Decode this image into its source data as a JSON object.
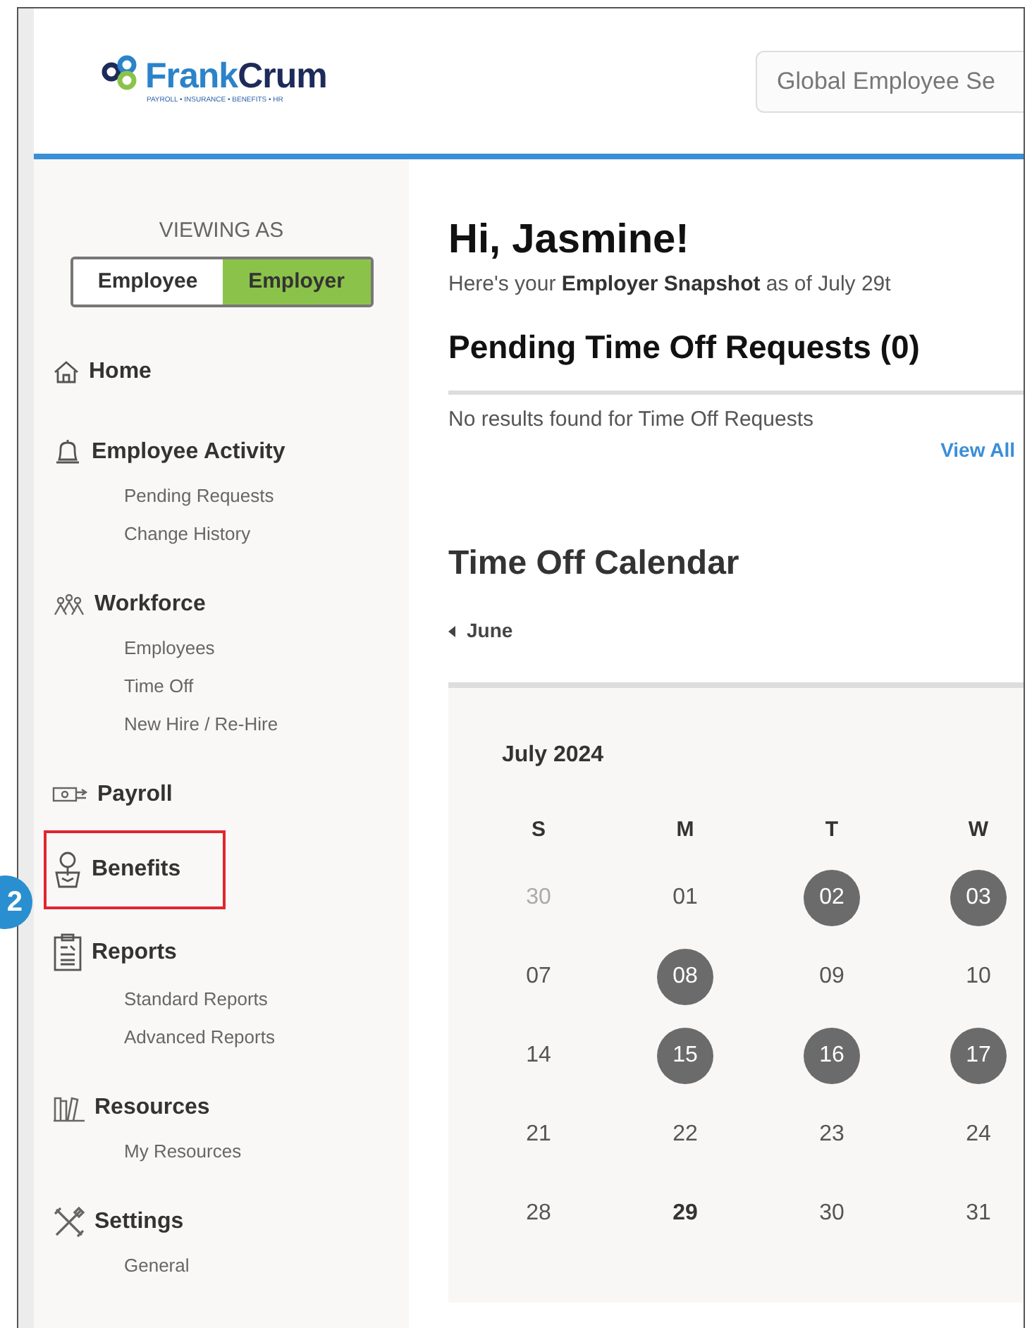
{
  "logo": {
    "name_parts": [
      "Frank",
      "Crum"
    ],
    "tagline": "PAYROLL • INSURANCE • BENEFITS • HR"
  },
  "search": {
    "placeholder": "Global Employee Se"
  },
  "viewing_as": {
    "label": "VIEWING AS",
    "options": [
      {
        "label": "Employee",
        "selected": false
      },
      {
        "label": "Employer",
        "selected": true
      }
    ]
  },
  "sidebar": {
    "items": [
      {
        "label": "Home",
        "highlighted": false
      },
      {
        "label": "Employee Activity",
        "highlighted": false,
        "children": [
          {
            "label": "Pending Requests"
          },
          {
            "label": "Change History"
          }
        ]
      },
      {
        "label": "Workforce",
        "highlighted": false,
        "children": [
          {
            "label": "Employees"
          },
          {
            "label": "Time Off"
          },
          {
            "label": "New Hire / Re-Hire"
          }
        ]
      },
      {
        "label": "Payroll",
        "highlighted": false
      },
      {
        "label": "Benefits",
        "highlighted": true
      },
      {
        "label": "Reports",
        "highlighted": false,
        "children": [
          {
            "label": "Standard Reports"
          },
          {
            "label": "Advanced Reports"
          }
        ]
      },
      {
        "label": "Resources",
        "highlighted": false,
        "children": [
          {
            "label": "My Resources"
          }
        ]
      },
      {
        "label": "Settings",
        "highlighted": false,
        "children": [
          {
            "label": "General"
          }
        ]
      }
    ]
  },
  "callout": {
    "label": "2"
  },
  "greeting": {
    "title": "Hi, Jasmine!",
    "subtitle": "Here's your **Employer Snapshot** as of July 29t"
  },
  "pending": {
    "title": "Pending Time Off Requests (0)",
    "empty_text": "No results found for Time Off Requests",
    "view_all": "View All"
  },
  "calendar": {
    "title": "Time Off Calendar",
    "previous": "June",
    "month": "July 2024",
    "weekdays": [
      "S",
      "M",
      "T",
      "W"
    ],
    "weeks": [
      [
        {
          "day": "30",
          "other_month": true,
          "time_off": false,
          "today": false
        },
        {
          "day": "01",
          "other_month": false,
          "time_off": false,
          "today": false
        },
        {
          "day": "02",
          "other_month": false,
          "time_off": true,
          "today": false
        },
        {
          "day": "03",
          "other_month": false,
          "time_off": true,
          "today": false
        }
      ],
      [
        {
          "day": "07",
          "other_month": false,
          "time_off": false,
          "today": false
        },
        {
          "day": "08",
          "other_month": false,
          "time_off": true,
          "today": false
        },
        {
          "day": "09",
          "other_month": false,
          "time_off": false,
          "today": false
        },
        {
          "day": "10",
          "other_month": false,
          "time_off": false,
          "today": false
        }
      ],
      [
        {
          "day": "14",
          "other_month": false,
          "time_off": false,
          "today": false
        },
        {
          "day": "15",
          "other_month": false,
          "time_off": true,
          "today": false
        },
        {
          "day": "16",
          "other_month": false,
          "time_off": true,
          "today": false
        },
        {
          "day": "17",
          "other_month": false,
          "time_off": true,
          "today": false
        }
      ],
      [
        {
          "day": "21",
          "other_month": false,
          "time_off": false,
          "today": false
        },
        {
          "day": "22",
          "other_month": false,
          "time_off": false,
          "today": false
        },
        {
          "day": "23",
          "other_month": false,
          "time_off": false,
          "today": false
        },
        {
          "day": "24",
          "other_month": false,
          "time_off": false,
          "today": false
        }
      ],
      [
        {
          "day": "28",
          "other_month": false,
          "time_off": false,
          "today": false
        },
        {
          "day": "29",
          "other_month": false,
          "time_off": false,
          "today": true
        },
        {
          "day": "30",
          "other_month": false,
          "time_off": false,
          "today": false
        },
        {
          "day": "31",
          "other_month": false,
          "time_off": false,
          "today": false
        }
      ]
    ]
  }
}
